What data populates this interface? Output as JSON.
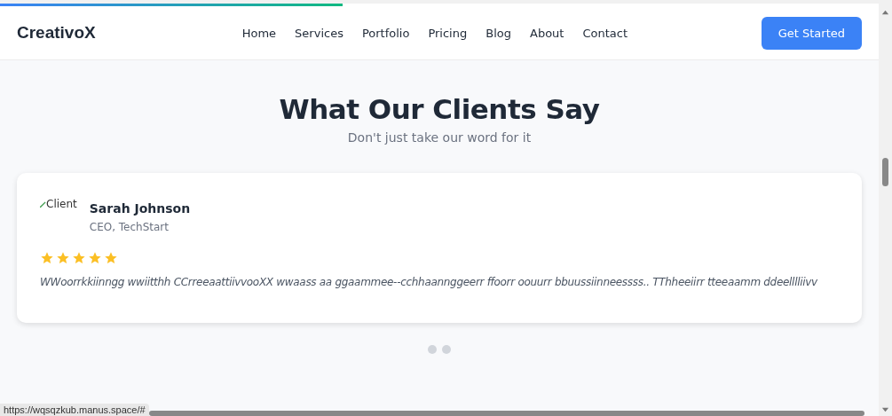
{
  "reading_progress": {
    "level": 0.39
  },
  "header": {
    "logo": "CreativoX",
    "nav": [
      {
        "label": "Home"
      },
      {
        "label": "Services"
      },
      {
        "label": "Portfolio"
      },
      {
        "label": "Pricing"
      },
      {
        "label": "Blog"
      },
      {
        "label": "About"
      },
      {
        "label": "Contact"
      }
    ],
    "cta": "Get Started"
  },
  "section": {
    "title": "What Our Clients Say",
    "subtitle": "Don't just take our word for it"
  },
  "testimonial": {
    "image_alt": "Client",
    "name": "Sarah Johnson",
    "role": "CEO, TechStart",
    "stars": 5,
    "quote": "WWoorrkkiinngg wwiitthh CCrreeaattiivvooXX wwaass aa ggaammee--cchhaannggeerr ffoorr oouurr bbuussiinneessss.. TThheeiirr tteeaamm ddeelllliivv"
  },
  "carousel_dots": [
    {
      "selected": false
    },
    {
      "selected": false
    }
  ],
  "status_url": "https://wqsqzkub.manus.space/#"
}
